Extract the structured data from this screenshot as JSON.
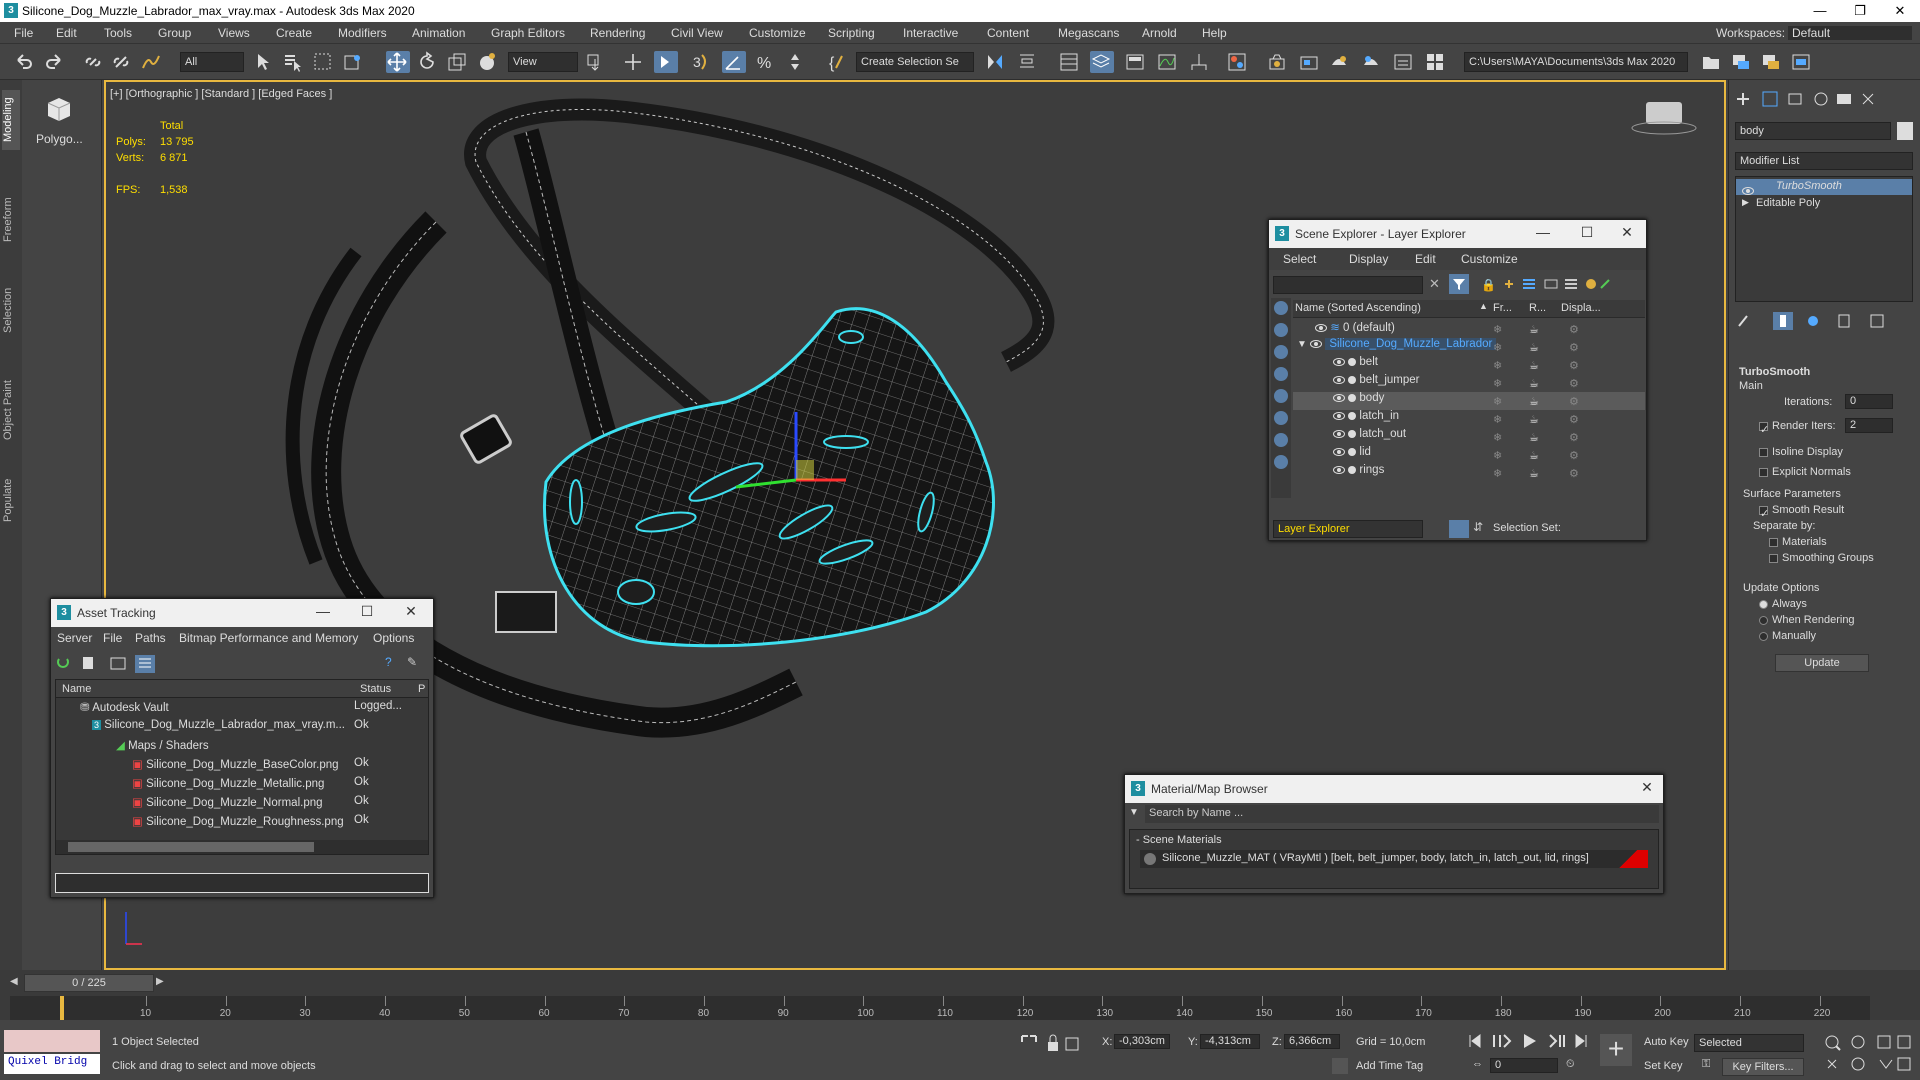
{
  "title": "Silicone_Dog_Muzzle_Labrador_max_vray.max - Autodesk 3ds Max 2020",
  "window_controls": {
    "min": "—",
    "max": "❐",
    "close": "✕"
  },
  "menu": [
    "File",
    "Edit",
    "Tools",
    "Group",
    "Views",
    "Create",
    "Modifiers",
    "Animation",
    "Graph Editors",
    "Rendering",
    "Civil View",
    "Customize",
    "Scripting",
    "Interactive",
    "Content",
    "Megascans",
    "Arnold",
    "Help"
  ],
  "workspaces": {
    "label": "Workspaces:",
    "value": "Default"
  },
  "toolbar": {
    "filter": "All",
    "ref_coord": "View",
    "selection_set": "Create Selection Se",
    "project_path": "C:\\Users\\MAYA\\Documents\\3ds Max 2020"
  },
  "left_tabs": [
    "Modeling",
    "Freeform",
    "Selection",
    "Object Paint",
    "Populate"
  ],
  "ribbon": {
    "label": "Polygo..."
  },
  "viewport": {
    "label": "[+] [Orthographic ] [Standard ] [Edged Faces ]",
    "stats": {
      "total": "Total",
      "polys_label": "Polys:",
      "polys": "13 795",
      "verts_label": "Verts:",
      "verts": "6 871",
      "fps_label": "FPS:",
      "fps": "1,538"
    }
  },
  "scene_explorer": {
    "title": "Scene Explorer - Layer Explorer",
    "menu": [
      "Select",
      "Display",
      "Edit",
      "Customize"
    ],
    "columns": [
      "Name (Sorted Ascending)",
      "Fr...",
      "R...",
      "Displa..."
    ],
    "rows": [
      {
        "name": "0 (default)",
        "level": 0
      },
      {
        "name": "Silicone_Dog_Muzzle_Labrador",
        "level": 1
      },
      {
        "name": "belt",
        "level": 2
      },
      {
        "name": "belt_jumper",
        "level": 2
      },
      {
        "name": "body",
        "level": 2
      },
      {
        "name": "latch_in",
        "level": 2
      },
      {
        "name": "latch_out",
        "level": 2
      },
      {
        "name": "lid",
        "level": 2
      },
      {
        "name": "rings",
        "level": 2
      }
    ],
    "footer": {
      "layer": "Layer Explorer",
      "selection_set": "Selection Set:"
    }
  },
  "asset_tracking": {
    "title": "Asset Tracking",
    "menu": [
      "Server",
      "File",
      "Paths",
      "Bitmap Performance and Memory",
      "Options"
    ],
    "columns": [
      "Name",
      "Status",
      "P"
    ],
    "rows": [
      {
        "name": "Autodesk Vault",
        "status": "Logged..."
      },
      {
        "name": "Silicone_Dog_Muzzle_Labrador_max_vray.m...",
        "status": "Ok"
      },
      {
        "name": "Maps / Shaders",
        "status": ""
      },
      {
        "name": "Silicone_Dog_Muzzle_BaseColor.png",
        "status": "Ok"
      },
      {
        "name": "Silicone_Dog_Muzzle_Metallic.png",
        "status": "Ok"
      },
      {
        "name": "Silicone_Dog_Muzzle_Normal.png",
        "status": "Ok"
      },
      {
        "name": "Silicone_Dog_Muzzle_Roughness.png",
        "status": "Ok"
      }
    ]
  },
  "material_browser": {
    "title": "Material/Map Browser",
    "search": "Search by Name ...",
    "group": "- Scene Materials",
    "item": "Silicone_Muzzle_MAT  ( VRayMtl )  [belt, belt_jumper, body, latch_in, latch_out, lid, rings]"
  },
  "command_panel": {
    "object_name": "body",
    "modifier_list": "Modifier List",
    "stack": [
      "TurboSmooth",
      "Editable Poly"
    ],
    "rollout": "TurboSmooth",
    "main": "Main",
    "iterations_label": "Iterations:",
    "iterations": "0",
    "render_iters_label": "Render Iters:",
    "render_iters": "2",
    "isoline": "Isoline Display",
    "explicit": "Explicit Normals",
    "surface": "Surface Parameters",
    "smooth_result": "Smooth Result",
    "separate": "Separate by:",
    "materials": "Materials",
    "smoothing": "Smoothing Groups",
    "update_options": "Update Options",
    "always": "Always",
    "when_rendering": "When Rendering",
    "manually": "Manually",
    "update": "Update"
  },
  "timeline": {
    "frame": "0 / 225",
    "ticks": [
      "10",
      "20",
      "30",
      "40",
      "50",
      "60",
      "70",
      "80",
      "90",
      "100",
      "110",
      "120",
      "130",
      "140",
      "150",
      "160",
      "170",
      "180",
      "190",
      "200",
      "210",
      "220"
    ]
  },
  "status": {
    "quixel": "Quixel Bridg",
    "selected": "1 Object Selected",
    "prompt": "Click and drag to select and move objects",
    "x_label": "X:",
    "x": "-0,303cm",
    "y_label": "Y:",
    "y": "-4,313cm",
    "z_label": "Z:",
    "z": "6,366cm",
    "grid": "Grid = 10,0cm",
    "add_time_tag": "Add Time Tag",
    "auto_key": "Auto Key",
    "set_key": "Set Key",
    "key_filters": "Key Filters...",
    "selected_dd": "Selected",
    "frame_field": "0"
  }
}
